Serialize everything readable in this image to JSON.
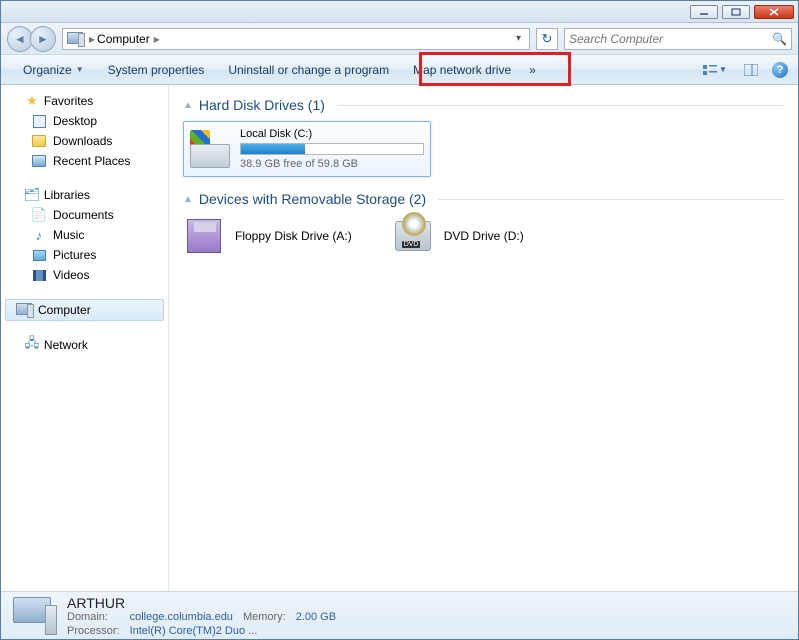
{
  "window": {
    "title": "Computer"
  },
  "nav": {
    "breadcrumb_root": "Computer",
    "breadcrumb_sep": "▸",
    "search_placeholder": "Search Computer"
  },
  "toolbar": {
    "organize": "Organize",
    "system_properties": "System properties",
    "uninstall": "Uninstall or change a program",
    "map_network": "Map network drive",
    "more": "»"
  },
  "sidebar": {
    "favorites": {
      "label": "Favorites",
      "items": [
        {
          "label": "Desktop"
        },
        {
          "label": "Downloads"
        },
        {
          "label": "Recent Places"
        }
      ]
    },
    "libraries": {
      "label": "Libraries",
      "items": [
        {
          "label": "Documents"
        },
        {
          "label": "Music"
        },
        {
          "label": "Pictures"
        },
        {
          "label": "Videos"
        }
      ]
    },
    "computer": {
      "label": "Computer"
    },
    "network": {
      "label": "Network"
    }
  },
  "content": {
    "hard_drives_heading": "Hard Disk Drives (1)",
    "local_disk": {
      "name": "Local Disk (C:)",
      "free_text": "38.9 GB free of 59.8 GB",
      "free_gb": 38.9,
      "total_gb": 59.8,
      "used_fraction_pct": 35
    },
    "removable_heading": "Devices with Removable Storage (2)",
    "floppy": {
      "name": "Floppy Disk Drive (A:)"
    },
    "dvd": {
      "name": "DVD Drive (D:)"
    }
  },
  "details": {
    "computer_name": "ARTHUR",
    "domain_label": "Domain:",
    "domain_value": "college.columbia.edu",
    "memory_label": "Memory:",
    "memory_value": "2.00 GB",
    "processor_label": "Processor:",
    "processor_value": "Intel(R) Core(TM)2 Duo ..."
  },
  "highlight": {
    "target": "map-network-drive"
  }
}
